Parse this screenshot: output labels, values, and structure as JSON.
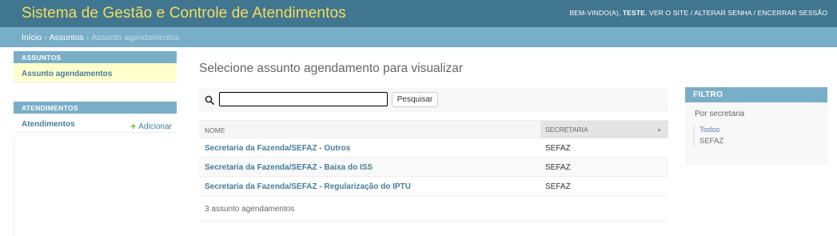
{
  "header": {
    "site_title": "Sistema de Gestão e Controle de Atendimentos",
    "welcome": "BEM-VINDO(A),",
    "username": "TESTE",
    "view_site": "VER O SITE",
    "change_password": "ALTERAR SENHA",
    "logout": "ENCERRAR SESSÃO",
    "separator": " / "
  },
  "breadcrumbs": {
    "home": "Início",
    "app": "Assuntos",
    "current": "Assunto agendamentos",
    "separator": "›"
  },
  "sidebar": {
    "modules": [
      {
        "caption": "ASSUNTOS",
        "items": [
          {
            "label": "Assunto agendamentos",
            "selected": true
          }
        ]
      },
      {
        "caption": "ATENDIMENTOS",
        "items": [
          {
            "label": "Atendimentos",
            "add_label": "Adicionar"
          }
        ]
      }
    ]
  },
  "content": {
    "title": "Selecione assunto agendamento para visualizar",
    "search": {
      "value": "",
      "placeholder": "",
      "button": "Pesquisar",
      "icon": "search-icon"
    },
    "table": {
      "columns": [
        "NOME",
        "SECRETARIA"
      ],
      "sort_indicator": "▲",
      "rows": [
        {
          "nome": "Secretaria da Fazenda/SEFAZ - Outros",
          "secretaria": "SEFAZ"
        },
        {
          "nome": "Secretaria da Fazenda/SEFAZ - Baixa do ISS",
          "secretaria": "SEFAZ"
        },
        {
          "nome": "Secretaria da Fazenda/SEFAZ - Regularização do IPTU",
          "secretaria": "SEFAZ"
        }
      ]
    },
    "result_count": "3 assunto agendamentos"
  },
  "filter": {
    "caption": "FILTRO",
    "heading": "Por secretaria",
    "options": [
      {
        "label": "Todos",
        "selected": true
      },
      {
        "label": "SEFAZ",
        "selected": false
      }
    ]
  },
  "colors": {
    "header_bg": "#417690",
    "breadcrumb_bg": "#79aec8",
    "site_title": "#f5dd5d",
    "link": "#447e9b",
    "selected_row": "#ffffcc",
    "add_icon": "#70bf2b"
  }
}
